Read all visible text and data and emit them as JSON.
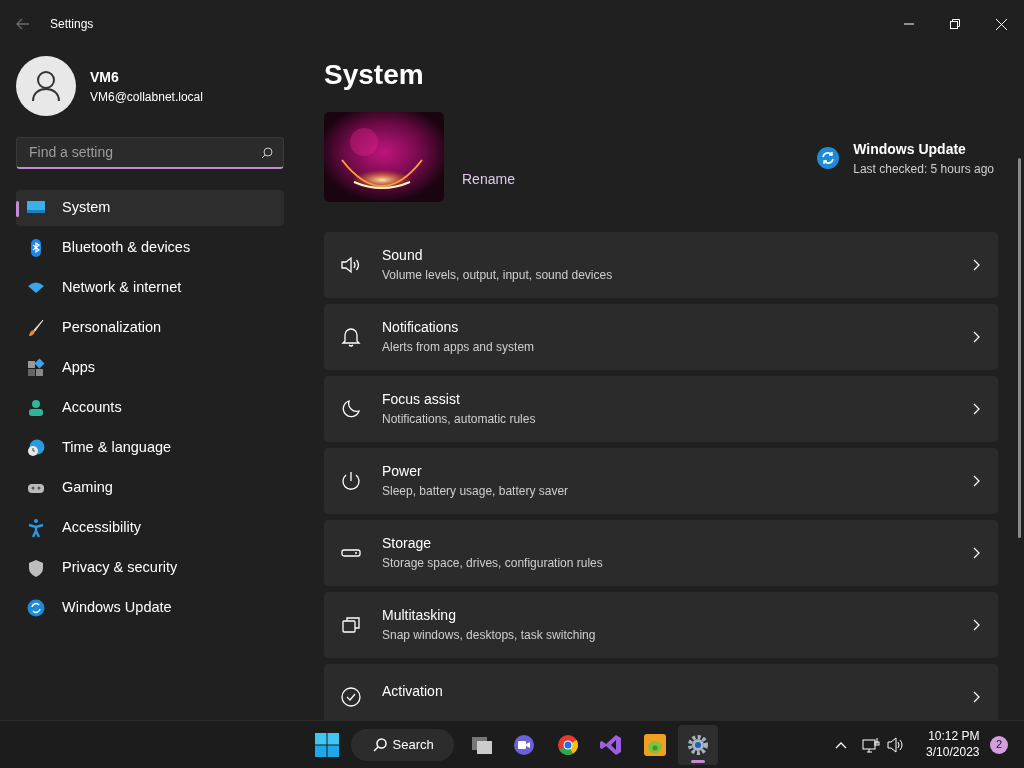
{
  "window": {
    "title": "Settings"
  },
  "account": {
    "name": "VM6",
    "email": "VM6@collabnet.local"
  },
  "search": {
    "placeholder": "Find a setting"
  },
  "sidebar": {
    "items": [
      {
        "kind": "system",
        "label": "System",
        "selected": true
      },
      {
        "kind": "bluetooth",
        "label": "Bluetooth & devices",
        "selected": false
      },
      {
        "kind": "network",
        "label": "Network & internet",
        "selected": false
      },
      {
        "kind": "personalization",
        "label": "Personalization",
        "selected": false
      },
      {
        "kind": "apps",
        "label": "Apps",
        "selected": false
      },
      {
        "kind": "accounts",
        "label": "Accounts",
        "selected": false
      },
      {
        "kind": "time",
        "label": "Time & language",
        "selected": false
      },
      {
        "kind": "gaming",
        "label": "Gaming",
        "selected": false
      },
      {
        "kind": "accessibility",
        "label": "Accessibility",
        "selected": false
      },
      {
        "kind": "privacy",
        "label": "Privacy & security",
        "selected": false
      },
      {
        "kind": "update",
        "label": "Windows Update",
        "selected": false
      }
    ]
  },
  "page": {
    "title": "System",
    "rename": "Rename",
    "update": {
      "title": "Windows Update",
      "status": "Last checked: 5 hours ago"
    }
  },
  "cards": [
    {
      "kind": "sound",
      "title": "Sound",
      "subtitle": "Volume levels, output, input, sound devices"
    },
    {
      "kind": "notifications",
      "title": "Notifications",
      "subtitle": "Alerts from apps and system"
    },
    {
      "kind": "focus",
      "title": "Focus assist",
      "subtitle": "Notifications, automatic rules"
    },
    {
      "kind": "power",
      "title": "Power",
      "subtitle": "Sleep, battery usage, battery saver"
    },
    {
      "kind": "storage",
      "title": "Storage",
      "subtitle": "Storage space, drives, configuration rules"
    },
    {
      "kind": "multitasking",
      "title": "Multitasking",
      "subtitle": "Snap windows, desktops, task switching"
    },
    {
      "kind": "activation",
      "title": "Activation"
    }
  ],
  "taskbar": {
    "search": "Search",
    "apps": [
      {
        "kind": "taskview",
        "selected": false
      },
      {
        "kind": "chat",
        "selected": false
      },
      {
        "kind": "browser",
        "selected": false
      },
      {
        "kind": "studio",
        "selected": false
      },
      {
        "kind": "game",
        "selected": false
      },
      {
        "kind": "settings",
        "selected": true
      }
    ],
    "time": "10:12 PM",
    "date": "3/10/2023",
    "notifications": "2"
  }
}
